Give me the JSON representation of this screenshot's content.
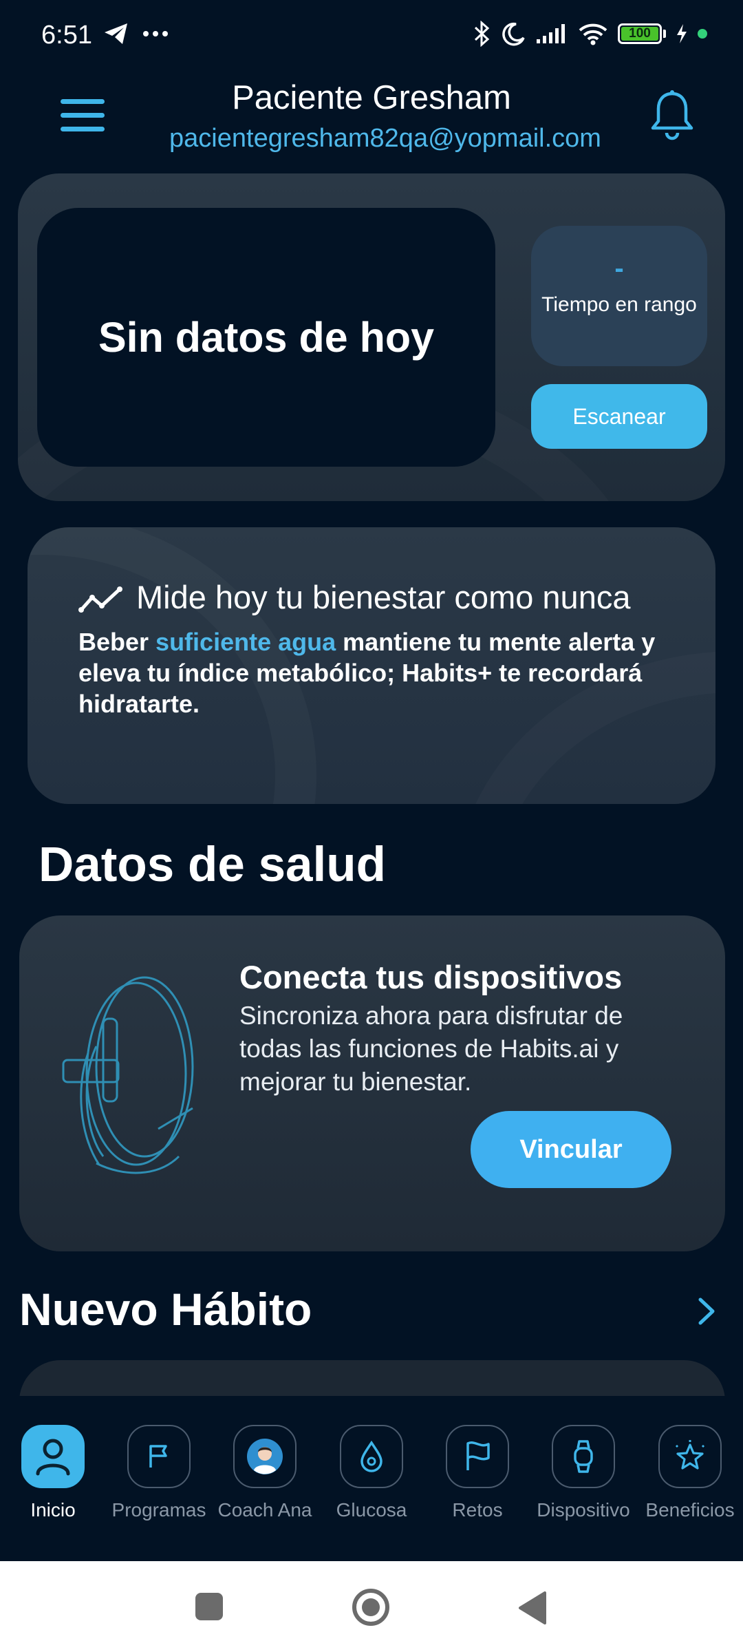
{
  "status_bar": {
    "time": "6:51",
    "battery_level": "100",
    "icons": [
      "telegram-icon",
      "more-icon",
      "bluetooth-icon",
      "moon-icon",
      "signal-icon",
      "wifi-icon",
      "battery-icon",
      "charging-icon"
    ]
  },
  "header": {
    "name": "Paciente Gresham",
    "email": "pacientegresham82qa@yopmail.com"
  },
  "today_card": {
    "empty_message": "Sin datos de hoy",
    "range_value": "-",
    "range_label": "Tiempo en rango",
    "scan_label": "Escanear"
  },
  "tip_card": {
    "title": "Mide hoy tu bienestar como nunca",
    "body_before": "Beber ",
    "body_highlight": "suficiente agua",
    "body_after": " mantiene tu mente alerta y eleva tu índice metabólico; Habits+ te recordará hidratarte."
  },
  "health": {
    "section_title": "Datos de salud",
    "device_title": "Conecta tus dispositivos",
    "device_text": "Sincroniza ahora para disfrutar de todas las funciones de Habits.ai y mejorar tu bienestar.",
    "link_label": "Vincular"
  },
  "habit": {
    "section_title": "Nuevo Hábito"
  },
  "bottom_nav": {
    "items": [
      {
        "label": "Inicio",
        "icon": "user-icon",
        "active": true
      },
      {
        "label": "Programas",
        "icon": "flag-icon",
        "active": false
      },
      {
        "label": "Coach Ana",
        "icon": "coach-avatar-icon",
        "active": false
      },
      {
        "label": "Glucosa",
        "icon": "drop-icon",
        "active": false
      },
      {
        "label": "Retos",
        "icon": "flag-icon",
        "active": false
      },
      {
        "label": "Dispositivo",
        "icon": "watch-icon",
        "active": false
      },
      {
        "label": "Beneficios",
        "icon": "star-icon",
        "active": false
      }
    ]
  },
  "colors": {
    "background": "#021224",
    "accent": "#40b8ea",
    "card": "#2a3846"
  }
}
